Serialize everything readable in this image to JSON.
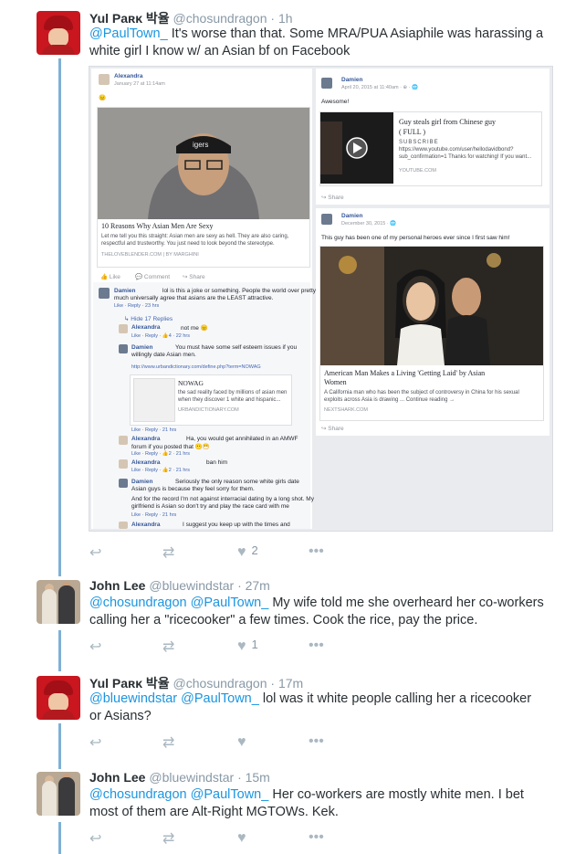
{
  "tweets": [
    {
      "name": "Yul Paʀκ 박율",
      "handle": "@chosundragon",
      "time": "· 1h",
      "mentions": "@PaulTown_",
      "text": "It's worse than that. Some MRA/PUA Asiaphile was harassing a white girl I know w/ an Asian bf on Facebook",
      "likes": "2"
    },
    {
      "name": "John Lee",
      "handle": "@bluewindstar",
      "time": "· 27m",
      "mentions": "@chosundragon @PaulTown_",
      "text": "My wife told me she overheard her co-workers calling her a \"ricecooker\" a few times. Cook the rice, pay the price.",
      "likes": "1"
    },
    {
      "name": "Yul Paʀκ 박율",
      "handle": "@chosundragon",
      "time": "· 17m",
      "mentions": "@bluewindstar @PaulTown_",
      "text": "lol was it white people calling her a ricecooker or Asians?",
      "likes": ""
    },
    {
      "name": "John Lee",
      "handle": "@bluewindstar",
      "time": "· 15m",
      "mentions": "@chosundragon @PaulTown_",
      "text": "Her co-workers are mostly white men. I bet most of them are Alt-Right MGTOWs. Kek.",
      "likes": ""
    }
  ],
  "icons": {
    "reply": "reply-icon",
    "retweet": "retweet-icon",
    "like": "heart-icon",
    "more": "more-icon"
  },
  "embed": {
    "left": {
      "author": "Alexandra",
      "date": "January 27 at 11:14am",
      "emoji": "😐",
      "photo_cap": "igers",
      "headline": "10 Reasons Why Asian Men Are Sexy",
      "body1": "Let me tell you this straight: Asian men are sexy as hell. They are also caring,",
      "body2": "respectful and trustworthy. You just need to look beyond the stereotype.",
      "source": "THELOVEBLENDER.COM | BY MARGHINI",
      "like": "Like",
      "comment": "Comment",
      "share": "Share",
      "c1_name": "Damien",
      "c1_text1": "lol is this a joke or something. People the world over pretty",
      "c1_text2": "much universally agree that asians are the LEAST attractive.",
      "c1_meta": "Like · Reply · 23 hrs",
      "hide": "Hide 17 Replies",
      "r1_name": "Alexandra",
      "r1_text": "not me 😐",
      "r1_meta": "Like · Reply · 👍4 · 22 hrs",
      "r2_name": "Damien",
      "r2_text1": "You must have some self esteem issues if you",
      "r2_text2": "willingly date Asian men.",
      "r2_url": "http://www.urbandictionary.com/define.php?term=NOWAG",
      "r2_card_title": "NOWAG",
      "r2_card_1": "the sad reality faced by millions of asian men",
      "r2_card_2": "when they discover 1 white and hispanic...",
      "r2_card_src": "URBANDICTIONARY.COM",
      "r2_meta": "Like · Reply · 21 hrs",
      "r3_name": "Alexandra",
      "r3_text1": "Ha, you would get annihilated in an AMWF",
      "r3_text2": "forum if you posted that 😶😷",
      "r3_meta": "Like · Reply · 👍2 · 21 hrs",
      "r4_name": "Alexandra",
      "r4_text": "ban him",
      "r4_meta": "Like · Reply · 👍2 · 21 hrs",
      "r5_name": "Damien",
      "r5_text1": "Seriously the only reason some white girls date",
      "r5_text2": "Asian guys is because they feel sorry for them.",
      "r5_text3": "And for the record I'm not against interracial dating by a long shot. My",
      "r5_text4": "girlfriend is Asian so don't try and play the race card with me",
      "r5_meta": "Like · Reply · 21 hrs",
      "r6_name": "Alexandra",
      "r6_text": "I suggest you keep up with the times and"
    },
    "right1": {
      "author": "Damien",
      "date": "April 20, 2015 at 11:40am · ⊕ · 🌐",
      "text": "Awesome!",
      "card_title1": "Guy steals girl from Chinese guy",
      "card_title2": "( FULL )",
      "card_sub": "SUBSCRIBE",
      "card_url1": "https://www.youtube.com/user/hellodavidbond?",
      "card_url2": "sub_confirmation=1 Thanks for watching! If you want...",
      "card_src": "YOUTUBE.COM",
      "share": "Share"
    },
    "right2": {
      "author": "Damien",
      "date": "December 30, 2015 · 🌐",
      "text": "This guy has been one of my personal heroes ever since I first saw him!",
      "card_title1": "American Man Makes a Living 'Getting Laid' by Asian",
      "card_title2": "Women",
      "card_body1": "A California man who has been the subject of controversy in China for his sexual",
      "card_body2": "exploits across Asia is drawing ... Continue reading →",
      "card_src": "NEXTSHARK.COM",
      "share": "Share"
    }
  }
}
